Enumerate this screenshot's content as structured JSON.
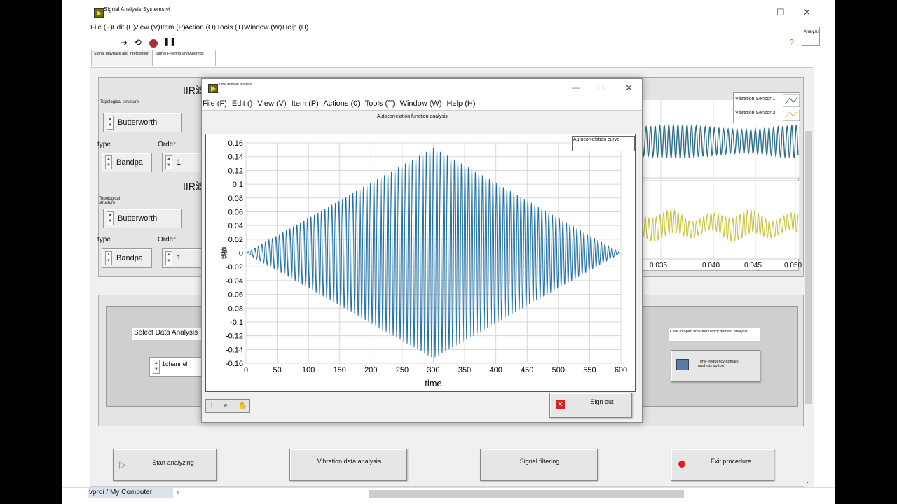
{
  "window": {
    "title": "Signal Analysis Systems.vi",
    "menu": [
      "File (F)",
      "Edit (E)",
      "View (V)",
      "Item (P)",
      "Action (O)",
      "Tools (T)",
      "Window (W)",
      "Help (H)"
    ],
    "corner_tag": "Analysis",
    "controls": {
      "minimize": "—",
      "maximize": "☐",
      "close": "✕"
    }
  },
  "tabs": [
    {
      "label": "Signal playback and interception",
      "active": false
    },
    {
      "label": "Signal Filtering and Analysis",
      "active": true
    }
  ],
  "filters": [
    {
      "heading": "IIR滤",
      "structure_label": "Topological structure",
      "structure_value": "Butterworth",
      "type_label": "type",
      "type_value": "Bandpa",
      "order_label": "Order",
      "order_value": "1"
    },
    {
      "heading": "IIR滤",
      "structure_label": "Topological structure",
      "structure_value": "Butterworth",
      "type_label": "type",
      "type_value": "Bandpa",
      "order_label": "Order",
      "order_value": "1"
    }
  ],
  "select_data": {
    "label": "Select Data Analysis",
    "value": "1channel"
  },
  "time_freq": {
    "caption": "Click to open time-frequency domain analysis",
    "button_label": "Time-frequency domain analysis button"
  },
  "legend": [
    {
      "name": "Vibration Sensor 1",
      "color": "#2e6f8a"
    },
    {
      "name": "Vibration Sensor 2",
      "color": "#c9c43a"
    }
  ],
  "bg_chart_xticks": [
    "0.035",
    "0.040",
    "0.045",
    "0.050"
  ],
  "bottom_buttons": {
    "start": "Start analyzing",
    "vibration": "Vibration data analysis",
    "filtering": "Signal filtering",
    "exit": "Exit procedure"
  },
  "status_path": "vproi / My Computer",
  "popup": {
    "title": "Time domain analysis",
    "menu": [
      "File (F)",
      "Edit ()",
      "View (V)",
      "Item (P)",
      "Actions (0)",
      "Tools (T)",
      "Window (W)",
      "Help (H)"
    ],
    "chart_heading": "Autocorrelation function analysis",
    "plot_legend": "Autocorrelation curve",
    "sign_out": "Sign out",
    "colors": {
      "trace": "#1f6fa8",
      "grid": "#d8d8d8"
    }
  },
  "chart_data": {
    "type": "line",
    "title": "Autocorrelation function analysis",
    "xlabel": "time",
    "ylabel": "幅值",
    "xlim": [
      0,
      600
    ],
    "ylim": [
      -0.16,
      0.16
    ],
    "x_ticks": [
      0,
      50,
      100,
      150,
      200,
      250,
      300,
      350,
      400,
      450,
      500,
      550,
      600
    ],
    "y_ticks": [
      0.16,
      0.14,
      0.12,
      0.1,
      0.08,
      0.06,
      0.04,
      0.02,
      0,
      -0.02,
      -0.04,
      -0.06,
      -0.08,
      -0.1,
      -0.12,
      -0.14,
      -0.16
    ],
    "grid": true,
    "series": [
      {
        "name": "Autocorrelation curve",
        "peak_x": 300,
        "peak_value": 0.153,
        "envelope_start_x": 0,
        "envelope_end_x": 600,
        "period": 5.6
      }
    ]
  }
}
